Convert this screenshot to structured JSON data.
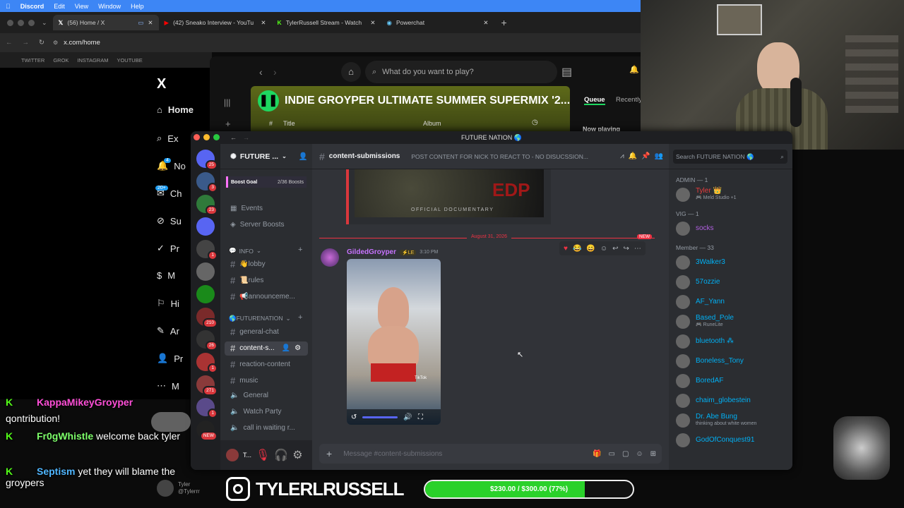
{
  "menubar": {
    "app": "Discord",
    "items": [
      "Edit",
      "View",
      "Window",
      "Help"
    ]
  },
  "browser": {
    "tabs": [
      {
        "label": "(56) Home / X"
      },
      {
        "label": "(42) Sneako Interview - YouTu"
      },
      {
        "label": "TylerRussell Stream - Watch"
      },
      {
        "label": "Powerchat"
      }
    ],
    "url": "x.com/home",
    "bookmarks": [
      "TWITTER",
      "GROK",
      "INSTAGRAM",
      "YOUTUBE"
    ]
  },
  "x_sidebar": {
    "logo": "X",
    "items": [
      {
        "label": "Home"
      },
      {
        "label": "Ex"
      },
      {
        "label": "No"
      },
      {
        "label": "Ch"
      },
      {
        "label": "Su"
      },
      {
        "label": "Pr"
      },
      {
        "label": "M"
      },
      {
        "label": "Hi"
      },
      {
        "label": "Ar"
      },
      {
        "label": "Pr"
      },
      {
        "label": "M"
      }
    ],
    "notif_badge": "4",
    "chat_badge": "20+"
  },
  "spotify": {
    "search_placeholder": "What do you want to play?",
    "playlist_title": "INDIE GROYPER ULTIMATE SUMMER SUPERMIX '2...",
    "col_hash": "#",
    "col_title": "Title",
    "col_album": "Album",
    "tab_queue": "Queue",
    "tab_recently": "Recently",
    "np": "Now playing"
  },
  "discord": {
    "window_title": "FUTURE NATION 🌎",
    "server_name": "FUTURE ...",
    "servers": [
      {
        "badge": "25"
      },
      {
        "badge": "3"
      },
      {
        "badge": "23"
      },
      {
        "badge": ""
      },
      {
        "badge": "1"
      },
      {
        "badge": ""
      },
      {
        "badge": ""
      },
      {
        "badge": "210"
      },
      {
        "badge": "26"
      },
      {
        "badge": "1"
      },
      {
        "badge": "271"
      },
      {
        "badge": "1"
      },
      {
        "badge": "NEW"
      }
    ],
    "boost": {
      "label": "Boost Goal",
      "count": "2/36 Boosts"
    },
    "menu": [
      "Events",
      "Server Boosts"
    ],
    "cat_info": "INFO",
    "info_channels": [
      "👋lobby",
      "📜rules",
      "📢announceme..."
    ],
    "cat_future": "🌎FUTURENATION",
    "channels": [
      "general-chat",
      "content-s...",
      "reaction-content",
      "music",
      "General",
      "Watch Party",
      "call in waiting r..."
    ],
    "user": {
      "name": "T..."
    },
    "channel_header": {
      "name": "content-submissions",
      "topic": "POST CONTENT FOR NICK TO REACT TO - NO DISUCSSION...",
      "search": "Search FUTURE NATION 🌎"
    },
    "embed_text": "OFFICIAL DOCUMENTARY",
    "embed_big": "EDP",
    "date_divider": "August 31, 2026",
    "new_badge": "NEW",
    "message": {
      "author": "GildedGroyper",
      "tag": "⚡LE",
      "time": "3:10 PM",
      "video_watermark": "TikTok"
    },
    "composer_placeholder": "Message #content-submissions",
    "members": {
      "admin_label": "ADMIN — 1",
      "admin": [
        {
          "name": "Tyler 👑",
          "sub": "🎮 Meld Studio +1",
          "color": "#e83d3d"
        }
      ],
      "vig_label": "VIG — 1",
      "vig": [
        {
          "name": "socks",
          "color": "#b05fe0"
        }
      ],
      "member_label": "Member — 33",
      "list": [
        {
          "name": "3Walker3",
          "sub": ""
        },
        {
          "name": "57ozzie",
          "sub": ""
        },
        {
          "name": "AF_Yann",
          "sub": ""
        },
        {
          "name": "Based_Pole",
          "sub": "🎮 RuneLite"
        },
        {
          "name": "bluetooth ⁂",
          "sub": ""
        },
        {
          "name": "Boneless_Tony",
          "sub": ""
        },
        {
          "name": "BoredAF",
          "sub": ""
        },
        {
          "name": "chaim_globestein",
          "sub": ""
        },
        {
          "name": "Dr. Abe Bung",
          "sub": "thinking about white women"
        },
        {
          "name": "GodOfConquest91",
          "sub": ""
        }
      ]
    }
  },
  "stream_chat": [
    {
      "user": "KappaMikeyGroyper",
      "user_color": "#ff4fd8",
      "text": "qontribution!"
    },
    {
      "user": "Fr0gWhistle",
      "user_color": "#7dff6a",
      "text": "welcome back tyler"
    },
    {
      "user": "Septism",
      "user_color": "#4fb6ff",
      "text": "yet they will blame the groypers"
    }
  ],
  "overlay": {
    "instagram_handle": "TYLERLRUSSELL",
    "donation_text": "$230.00 / $300.00 (77%)",
    "donation_fraction": 0.77,
    "profile_name": "Tyler",
    "profile_handle": "@Tylerrr"
  }
}
